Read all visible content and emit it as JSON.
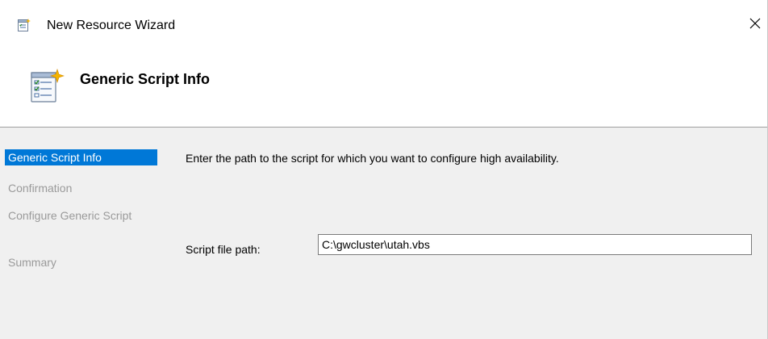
{
  "window": {
    "title": "New Resource Wizard",
    "close_glyph": "✕"
  },
  "header": {
    "title": "Generic Script Info"
  },
  "nav": {
    "items": [
      {
        "label": "Generic Script Info",
        "selected": true
      },
      {
        "label": "Confirmation",
        "selected": false
      },
      {
        "label": "Configure Generic Script",
        "selected": false
      },
      {
        "label": "Summary",
        "selected": false
      }
    ]
  },
  "main": {
    "instructions": "Enter the path to the script for which you want to configure high availability.",
    "script_path_label": "Script file path:",
    "script_path_value": "C:\\gwcluster\\utah.vbs"
  },
  "colors": {
    "selection": "#0078d7",
    "panel_bg": "#f0f0f0",
    "disabled_text": "#9a9a9a"
  },
  "icons": {
    "title": "wizard-icon",
    "header": "wizard-document-icon",
    "close": "close-icon"
  }
}
